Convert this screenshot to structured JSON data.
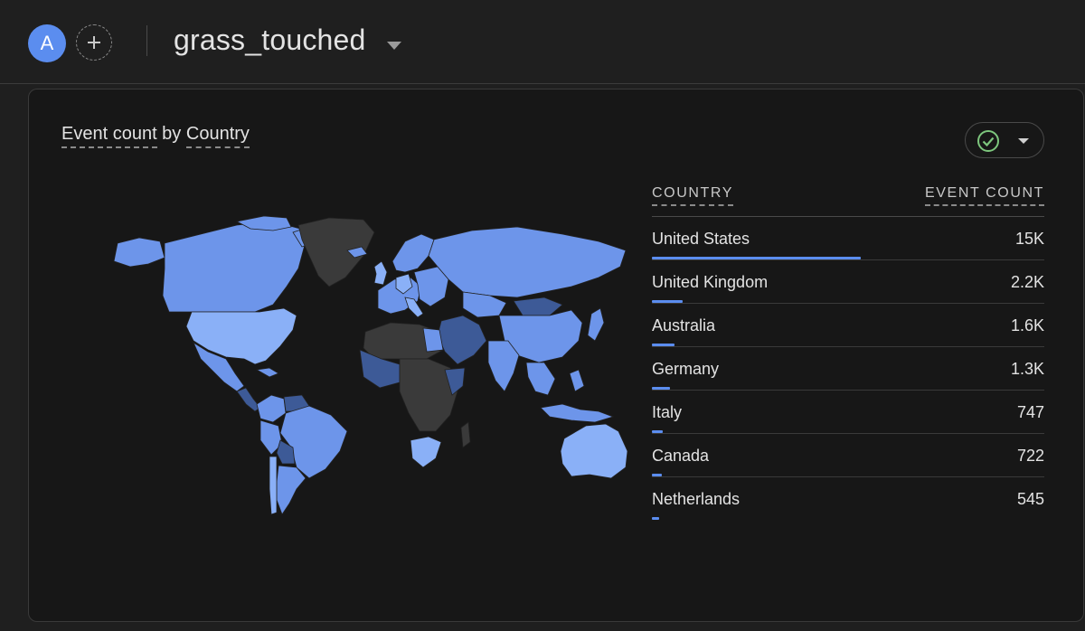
{
  "header": {
    "avatar_letter": "A",
    "add_icon": "plus-icon",
    "property_name": "grass_touched"
  },
  "card": {
    "title_metric": "Event count",
    "title_by": " by ",
    "title_dimension": "Country",
    "compare_icon": "check-circle-icon",
    "check_color": "#7dc67d"
  },
  "colors": {
    "accent": "#5b8def",
    "map_high": "#8ab0f7",
    "map_mid": "#6d95ea",
    "map_low": "#3d5a97",
    "map_none": "#3a3a3a"
  },
  "table": {
    "col_country": "COUNTRY",
    "col_count": "EVENT COUNT",
    "rows": [
      {
        "country": "United States",
        "count": "15K",
        "fraction": 1.0
      },
      {
        "country": "United Kingdom",
        "count": "2.2K",
        "fraction": 0.147
      },
      {
        "country": "Australia",
        "count": "1.6K",
        "fraction": 0.107
      },
      {
        "country": "Germany",
        "count": "1.3K",
        "fraction": 0.087
      },
      {
        "country": "Italy",
        "count": "747",
        "fraction": 0.05
      },
      {
        "country": "Canada",
        "count": "722",
        "fraction": 0.048
      },
      {
        "country": "Netherlands",
        "count": "545",
        "fraction": 0.036
      }
    ]
  }
}
